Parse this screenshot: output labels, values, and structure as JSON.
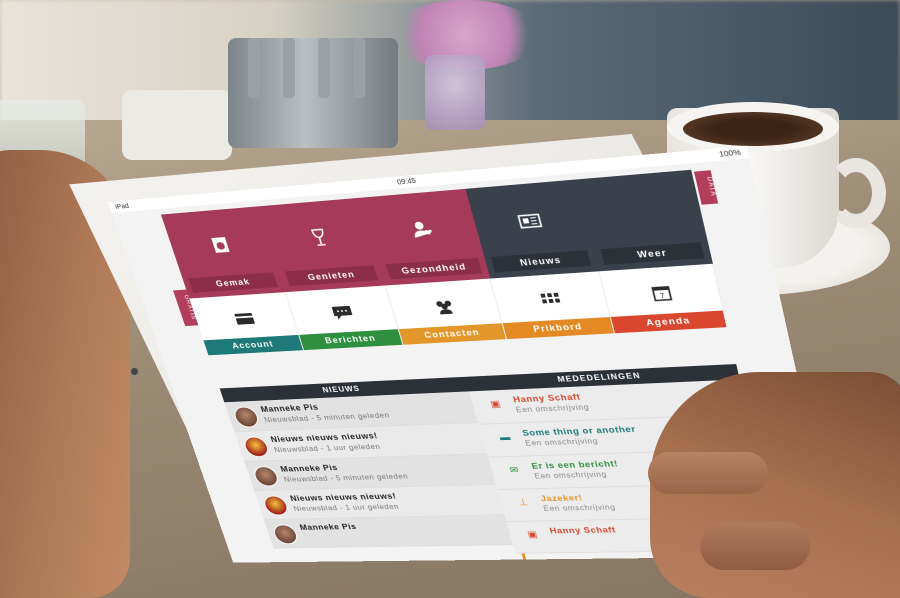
{
  "status_bar": {
    "device": "iPad",
    "time": "09:45",
    "battery": "100%"
  },
  "side_tabs": {
    "left": "GRATIS",
    "right": "DATA"
  },
  "tiles_top": [
    {
      "label": "Gemak",
      "icon": "washing-machine-icon",
      "color": "#a53a5a"
    },
    {
      "label": "Genieten",
      "icon": "wine-glass-icon",
      "color": "#a53a5a"
    },
    {
      "label": "Gezondheid",
      "icon": "person-heart-icon",
      "color": "#a53a5a"
    },
    {
      "label": "Nieuws",
      "icon": "newspaper-icon",
      "color": "#3b414b"
    },
    {
      "label": "Weer",
      "icon": "",
      "color": "#3b414b"
    }
  ],
  "tiles_bottom": [
    {
      "label": "Account",
      "icon": "card-icon",
      "color": "#1e7a78"
    },
    {
      "label": "Berichten",
      "icon": "chat-icon",
      "color": "#2e8f3e"
    },
    {
      "label": "Contacten",
      "icon": "people-icon",
      "color": "#e3972a"
    },
    {
      "label": "Prikbord",
      "icon": "grid-icon",
      "color": "#e38a25"
    },
    {
      "label": "Agenda",
      "icon": "calendar-icon",
      "color": "#d9472e"
    }
  ],
  "news": {
    "heading": "NIEUWS",
    "items": [
      {
        "title": "Manneke Pis",
        "sub": "Nieuwsblad - 5 minuten geleden"
      },
      {
        "title": "Nieuws nieuws nieuws!",
        "sub": "Nieuwsblad - 1 uur geleden"
      },
      {
        "title": "Manneke Pis",
        "sub": "Nieuwsblad - 5 minuten geleden"
      },
      {
        "title": "Nieuws nieuws nieuws!",
        "sub": "Nieuwsblad - 1 uur geleden"
      },
      {
        "title": "Manneke Pis",
        "sub": ""
      }
    ]
  },
  "messages": {
    "heading": "MEDEDELINGEN",
    "items": [
      {
        "title": "Hanny Schaft",
        "sub": "Een omschrijving",
        "color": "#d9472e",
        "icon": "calendar-icon"
      },
      {
        "title": "Some thing or another",
        "sub": "Een omschrijving",
        "color": "#2e8f3e",
        "icon": "card-icon"
      },
      {
        "title": "Er is een bericht!",
        "sub": "Een omschrijving",
        "color": "#2e8f3e",
        "icon": "chat-icon"
      },
      {
        "title": "Jazeker!",
        "sub": "Een omschrijving",
        "color": "#e3972a",
        "icon": "pin-icon"
      },
      {
        "title": "Hanny Schaft",
        "sub": "",
        "color": "#d9472e",
        "icon": "calendar-icon"
      }
    ]
  }
}
